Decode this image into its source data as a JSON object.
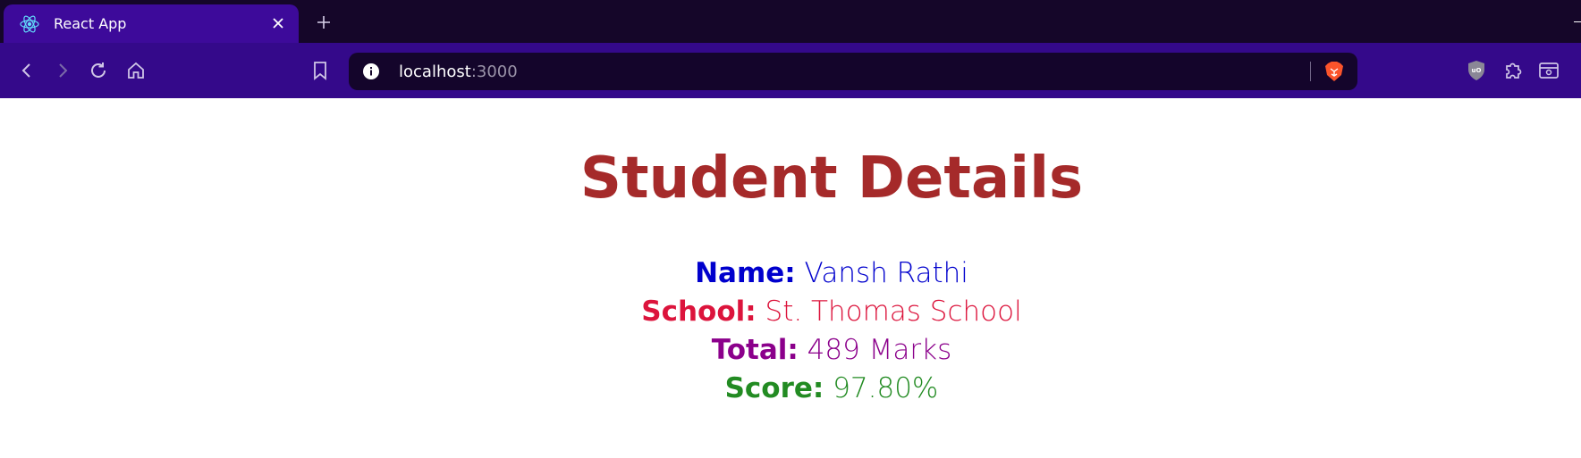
{
  "browser": {
    "tab": {
      "title": "React App",
      "favicon_icon": "react-logo-icon",
      "close_icon": "close-icon"
    },
    "new_tab_icon": "plus-icon",
    "toolbar": {
      "back_icon": "chevron-left-icon",
      "forward_icon": "chevron-right-icon",
      "reload_icon": "reload-icon",
      "home_icon": "home-icon",
      "bookmark_icon": "bookmark-icon",
      "site_info_icon": "info-icon",
      "url_host": "localhost",
      "url_port": ":3000",
      "brave_shields_icon": "brave-lion-icon",
      "extensions": [
        "ublock-origin-icon",
        "puzzle-extensions-icon",
        "wallet-icon"
      ]
    },
    "colors": {
      "tabstrip": "#150629",
      "active_tab": "#3d0a9a",
      "toolbar": "#34098a",
      "omnibox": "#14052b"
    }
  },
  "page": {
    "heading": "Student Details",
    "heading_color": "#a52a2a",
    "details": [
      {
        "label": "Name:",
        "value": "Vansh Rathi",
        "color": "#0000cd"
      },
      {
        "label": "School:",
        "value": "St. Thomas School",
        "color": "#dc143c"
      },
      {
        "label": "Total:",
        "value": "489 Marks",
        "color": "#8b008b"
      },
      {
        "label": "Score:",
        "value": "97.80%",
        "color": "#228b22"
      }
    ]
  }
}
